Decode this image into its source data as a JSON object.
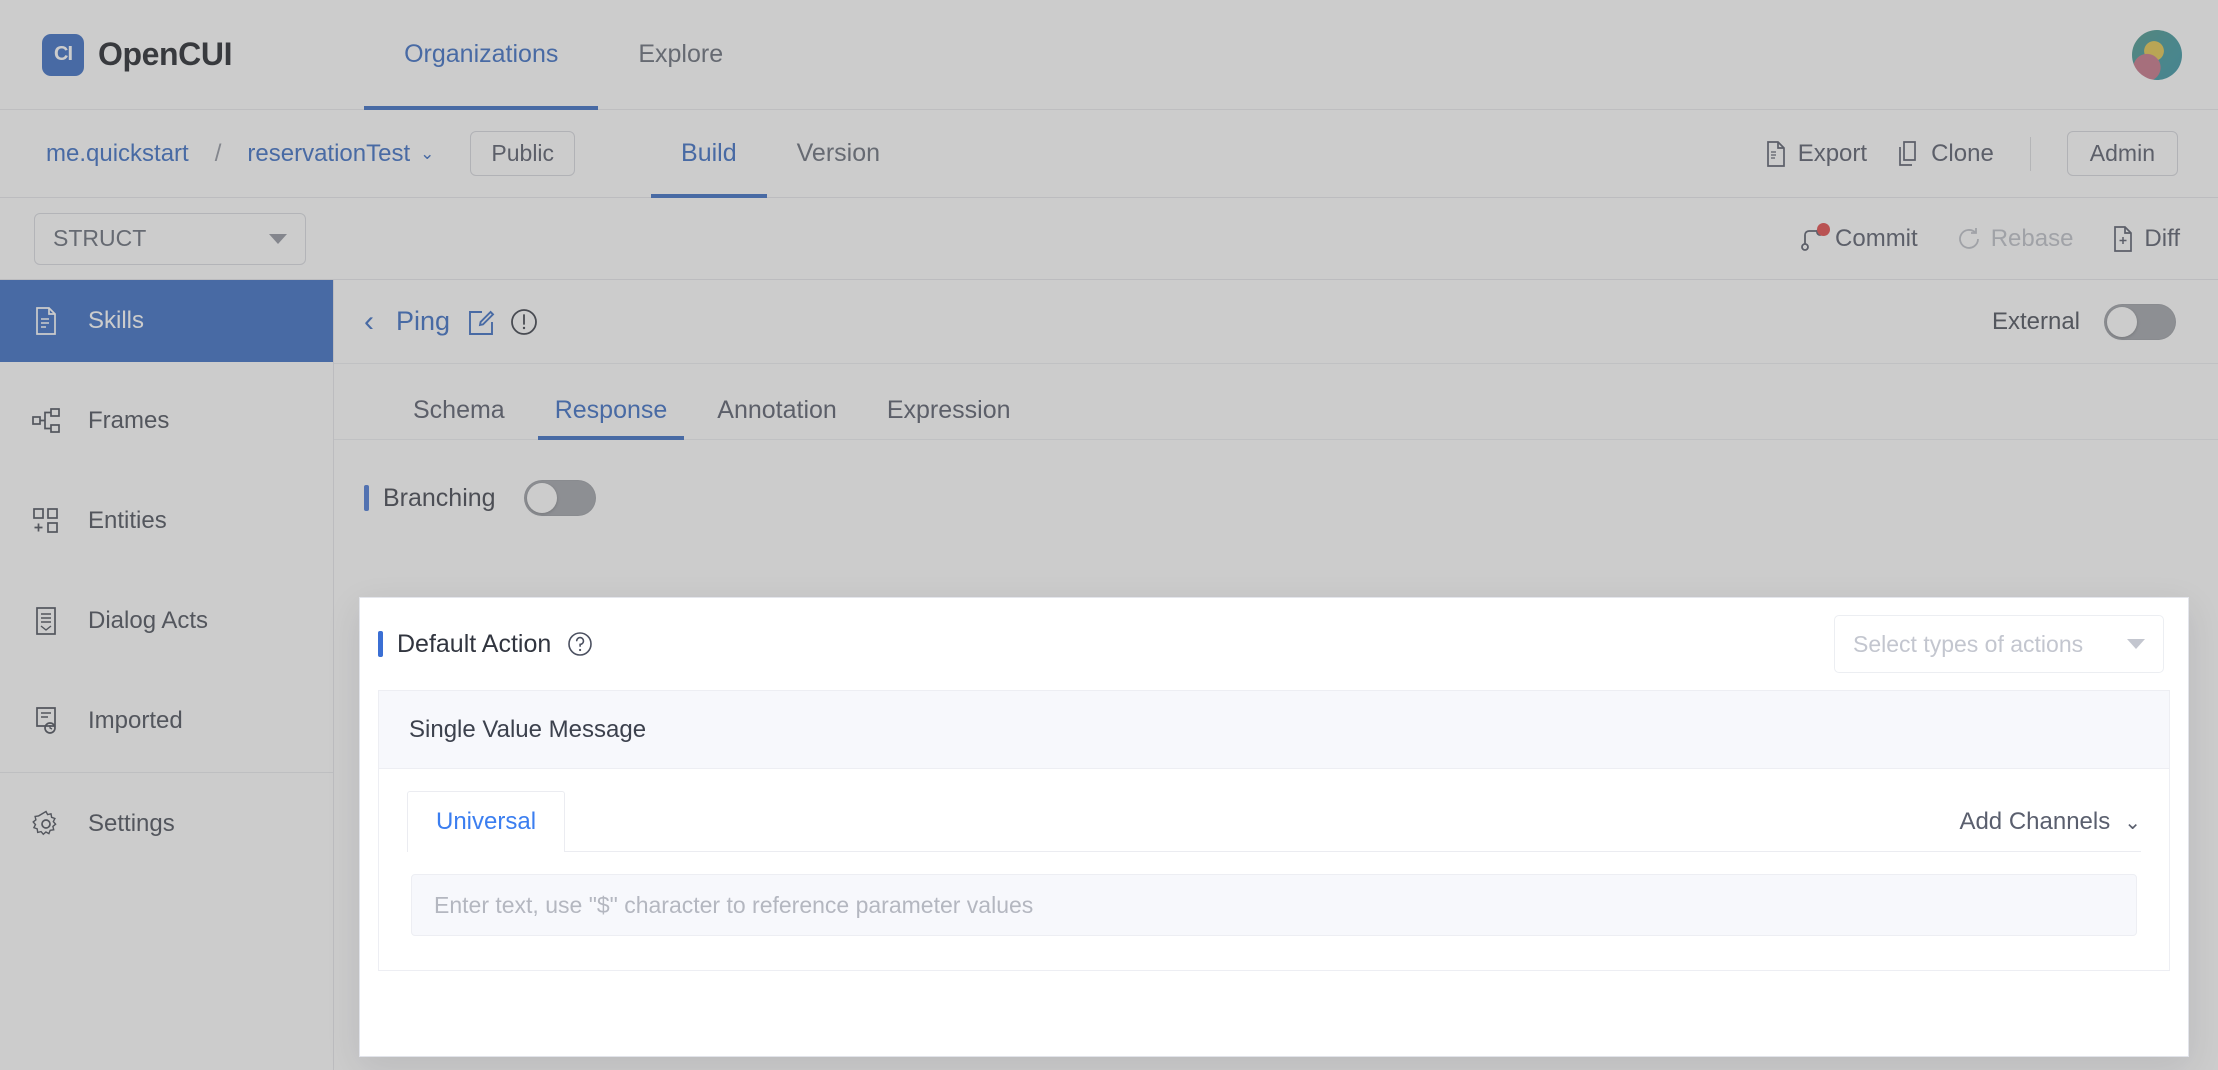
{
  "topnav": {
    "brand_mark": "CI",
    "brand_name": "OpenCUI",
    "tabs": [
      {
        "label": "Organizations",
        "active": true
      },
      {
        "label": "Explore",
        "active": false
      }
    ],
    "avatar_icon": "user-avatar"
  },
  "breadcrumb": {
    "org": "me.quickstart",
    "separator": "/",
    "project": "reservationTest",
    "project_caret": "⌄",
    "visibility": "Public",
    "tabs": [
      {
        "label": "Build",
        "active": true
      },
      {
        "label": "Version",
        "active": false
      }
    ],
    "actions": {
      "export": "Export",
      "clone": "Clone",
      "admin": "Admin"
    }
  },
  "toolbar": {
    "struct_value": "STRUCT",
    "commit": "Commit",
    "rebase": "Rebase",
    "diff": "Diff",
    "commit_has_changes": true
  },
  "sidebar": {
    "items": [
      {
        "label": "Skills",
        "icon": "document-icon",
        "active": true
      },
      {
        "label": "Frames",
        "icon": "sitemap-icon",
        "active": false
      },
      {
        "label": "Entities",
        "icon": "add-block-icon",
        "active": false
      },
      {
        "label": "Dialog Acts",
        "icon": "list-doc-icon",
        "active": false
      },
      {
        "label": "Imported",
        "icon": "doc-refresh-icon",
        "active": false
      },
      {
        "label": "Settings",
        "icon": "gear-icon",
        "active": false
      }
    ]
  },
  "main": {
    "back_chevron": "‹",
    "title": "Ping",
    "edit_icon": "edit-square-icon",
    "warning_icon": "exclamation-circle-icon",
    "external_label": "External",
    "external_on": false,
    "tabs": [
      {
        "label": "Schema",
        "active": false
      },
      {
        "label": "Response",
        "active": true
      },
      {
        "label": "Annotation",
        "active": false
      },
      {
        "label": "Expression",
        "active": false
      }
    ],
    "branching": {
      "label": "Branching",
      "enabled": false
    }
  },
  "default_action": {
    "title": "Default Action",
    "help_icon": "question-circle-icon",
    "select_placeholder": "Select types of actions",
    "message_block": {
      "header": "Single Value Message",
      "channel_tabs": [
        {
          "label": "Universal",
          "active": true
        }
      ],
      "add_channels": "Add Channels",
      "add_channels_caret": "⌄",
      "input_placeholder": "Enter text, use \"$\" character to reference parameter values",
      "input_value": ""
    }
  },
  "colors": {
    "accent_blue": "#2b62bf",
    "link_blue": "#3b7ef0",
    "commit_dot_red": "#e03b3b",
    "panel_bg": "#f7f8fc"
  }
}
